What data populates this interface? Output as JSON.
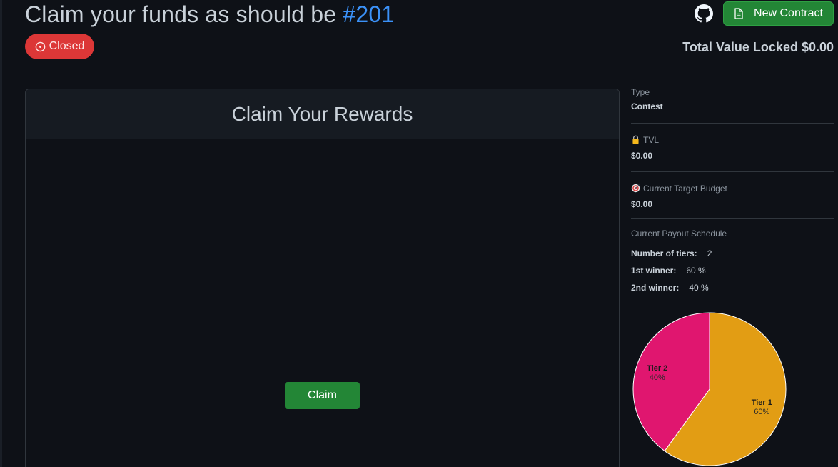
{
  "header": {
    "title_prefix": "Claim your funds as should be",
    "title_number": "#201",
    "status": "Closed",
    "new_contract_label": "New Contract",
    "total_value_locked": "Total Value Locked $0.00"
  },
  "card": {
    "title": "Claim Your Rewards",
    "claim_label": "Claim"
  },
  "sidebar": {
    "type_label": "Type",
    "type_value": "Contest",
    "tvl_label": "TVL",
    "tvl_value": "$0.00",
    "budget_label": "Current Target Budget",
    "budget_value": "$0.00",
    "payout_label": "Current Payout Schedule",
    "tiers_label": "Number of tiers:",
    "tiers_value": "2",
    "first_label": "1st winner:",
    "first_value": "60 %",
    "second_label": "2nd winner:",
    "second_value": "40 %"
  },
  "chart_data": {
    "type": "pie",
    "categories": [
      "Tier 1",
      "Tier 2"
    ],
    "values": [
      60,
      40
    ],
    "value_labels": [
      "60%",
      "40%"
    ],
    "colors": [
      "#e29d14",
      "#e0166f"
    ]
  },
  "colors": {
    "background": "#0e1117",
    "accent_link": "#3b91f7",
    "success": "#238636",
    "danger": "#dc3737"
  },
  "icons": [
    "github-icon",
    "document-icon",
    "circle-dot-icon",
    "lock-icon",
    "target-icon"
  ]
}
